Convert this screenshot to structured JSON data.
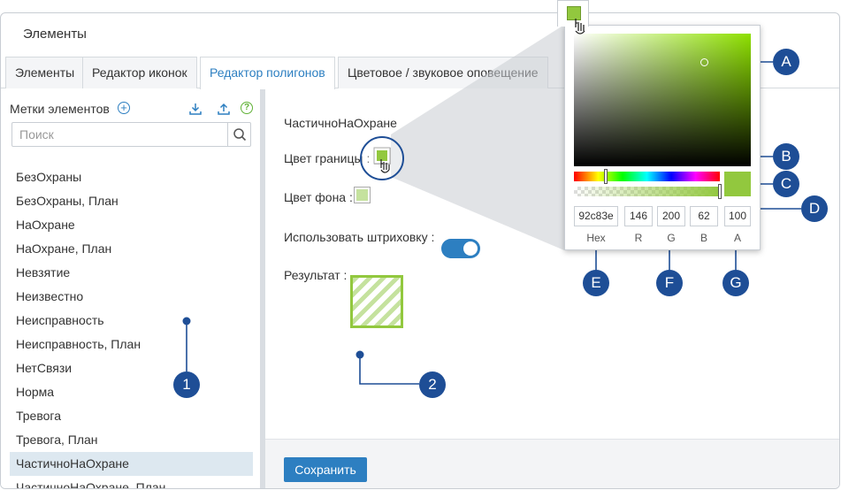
{
  "window": {
    "title": "Элементы"
  },
  "tabs": [
    {
      "label": "Элементы"
    },
    {
      "label": "Редактор иконок"
    },
    {
      "label": "Редактор полигонов"
    },
    {
      "label": "Цветовое / звуковое оповещение"
    }
  ],
  "active_tab": "Редактор полигонов",
  "sidebar": {
    "header": "Метки элементов",
    "search_placeholder": "Поиск",
    "items": [
      "БезОхраны",
      "БезОхраны, План",
      "НаОхране",
      "НаОхране, План",
      "Невзятие",
      "Неизвестно",
      "Неисправность",
      "Неисправность, План",
      "НетСвязи",
      "Норма",
      "Тревога",
      "Тревога, План",
      "ЧастичноНаОхране",
      "ЧастичноНаОхране, План"
    ],
    "selected_item": "ЧастичноНаОхране"
  },
  "editor": {
    "element_name": "ЧастичноНаОхране",
    "border_color_label": "Цвет границы :",
    "border_color": "#92c83e",
    "fill_color_label": "Цвет фона :",
    "fill_color": "#c5e29e",
    "hatch_label": "Использовать штриховку :",
    "hatch_enabled": true,
    "result_label": "Результат :"
  },
  "footer": {
    "save_label": "Сохранить"
  },
  "picker": {
    "hex": "92c83e",
    "r": "146",
    "g": "200",
    "b": "62",
    "a": "100",
    "labels": {
      "hex": "Hex",
      "r": "R",
      "g": "G",
      "b": "B",
      "a": "A"
    }
  },
  "callouts": {
    "a": "A",
    "b": "B",
    "c": "C",
    "d": "D",
    "e": "E",
    "f": "F",
    "g": "G",
    "one": "1",
    "two": "2"
  },
  "colors": {
    "accent": "#2d7fc1",
    "callout": "#1e4e96",
    "selected_row": "#dde8f0",
    "polygon_border": "#92c83e"
  }
}
